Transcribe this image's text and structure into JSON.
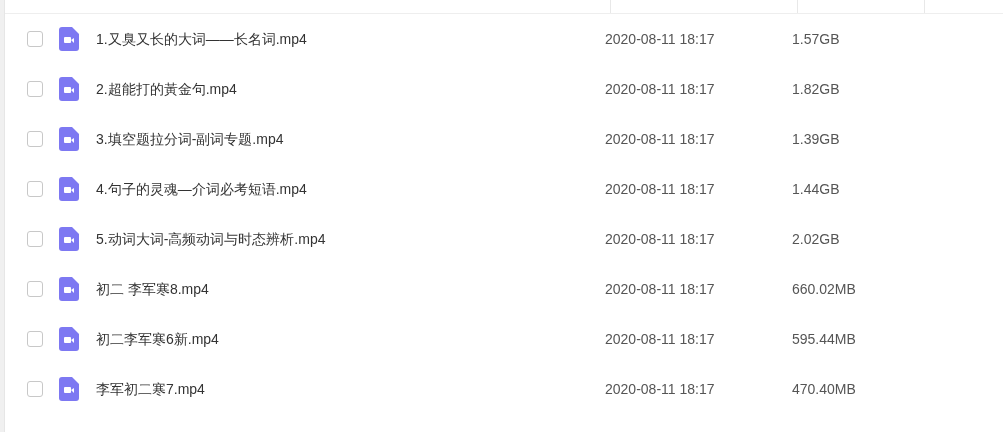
{
  "rows": [
    {
      "name": "1.又臭又长的大词——长名词.mp4",
      "date": "2020-08-11 18:17",
      "size": "1.57GB",
      "checked": false
    },
    {
      "name": "2.超能打的黃金句.mp4",
      "date": "2020-08-11 18:17",
      "size": "1.82GB",
      "checked": false
    },
    {
      "name": "3.填空题拉分词-副词专题.mp4",
      "date": "2020-08-11 18:17",
      "size": "1.39GB",
      "checked": false
    },
    {
      "name": "4.句子的灵魂—介词必考短语.mp4",
      "date": "2020-08-11 18:17",
      "size": "1.44GB",
      "checked": false
    },
    {
      "name": "5.动词大词-高频动词与时态辨析.mp4",
      "date": "2020-08-11 18:17",
      "size": "2.02GB",
      "checked": false
    },
    {
      "name": "初二 李军寒8.mp4",
      "date": "2020-08-11 18:17",
      "size": "660.02MB",
      "checked": false
    },
    {
      "name": "初二李军寒6新.mp4",
      "date": "2020-08-11 18:17",
      "size": "595.44MB",
      "checked": false
    },
    {
      "name": "李军初二寒7.mp4",
      "date": "2020-08-11 18:17",
      "size": "470.40MB",
      "checked": false
    }
  ]
}
